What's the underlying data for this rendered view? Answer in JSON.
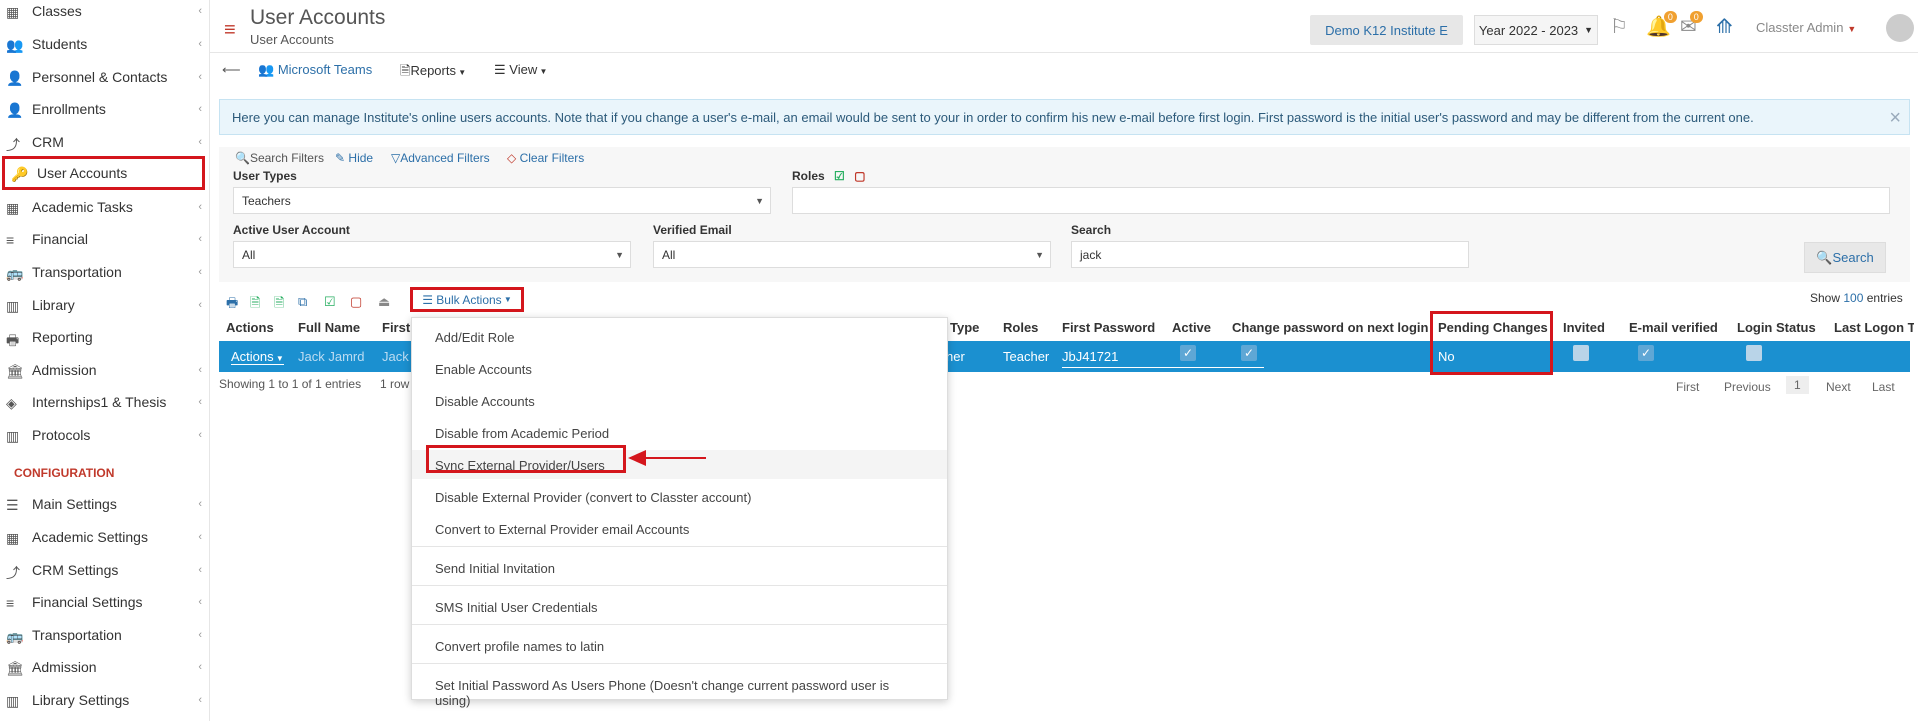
{
  "sidebar": {
    "items": [
      {
        "label": "Classes",
        "icon": "classes-icon"
      },
      {
        "label": "Students",
        "icon": "students-icon"
      },
      {
        "label": "Personnel & Contacts",
        "icon": "personnel-icon"
      },
      {
        "label": "Enrollments",
        "icon": "enrollments-icon"
      },
      {
        "label": "CRM",
        "icon": "crm-icon"
      },
      {
        "label": "User Accounts",
        "icon": "key-icon"
      },
      {
        "label": "Academic Tasks",
        "icon": "tasks-icon"
      },
      {
        "label": "Financial",
        "icon": "financial-icon"
      },
      {
        "label": "Transportation",
        "icon": "bus-icon"
      },
      {
        "label": "Library",
        "icon": "library-icon"
      },
      {
        "label": "Reporting",
        "icon": "reporting-icon"
      },
      {
        "label": "Admission",
        "icon": "admission-icon"
      },
      {
        "label": "Internships1 & Thesis",
        "icon": "internship-icon"
      },
      {
        "label": "Protocols",
        "icon": "protocols-icon"
      }
    ],
    "config_heading": "CONFIGURATION",
    "config_items": [
      {
        "label": "Main Settings",
        "icon": "settings-icon"
      },
      {
        "label": "Academic Settings",
        "icon": "classes-icon"
      },
      {
        "label": "CRM Settings",
        "icon": "crm-icon"
      },
      {
        "label": "Financial Settings",
        "icon": "financial-icon"
      },
      {
        "label": "Transportation",
        "icon": "bus-icon"
      },
      {
        "label": "Admission",
        "icon": "admission-icon"
      },
      {
        "label": "Library Settings",
        "icon": "library-icon"
      }
    ]
  },
  "header": {
    "title": "User Accounts",
    "subtitle": "User Accounts",
    "institute": "Demo K12 Institute E",
    "year": "Year 2022 - 2023",
    "notif_count": "0",
    "mail_count": "0",
    "user": "Classter Admin"
  },
  "toolbar": {
    "teams": "Microsoft Teams",
    "reports": "Reports",
    "view": "View"
  },
  "notice": "Here you can manage Institute's online users accounts. Note that if you change a user's e-mail, an email would be sent to your in order to confirm his new e-mail before first login. First password is the initial user's password and may be different from the current one.",
  "filters": {
    "search_filters": "Search Filters",
    "hide": "Hide",
    "advanced": "Advanced Filters",
    "clear": "Clear Filters",
    "user_types_label": "User Types",
    "user_types_value": "Teachers",
    "roles_label": "Roles",
    "active_label": "Active User Account",
    "active_value": "All",
    "verified_label": "Verified Email",
    "verified_value": "All",
    "search_label": "Search",
    "search_value": "jack",
    "search_button": "Search"
  },
  "table": {
    "bulk_actions": "Bulk Actions",
    "show_prefix": "Show",
    "show_count": "100",
    "show_suffix": "entries",
    "headers": {
      "actions": "Actions",
      "full_name": "Full Name",
      "first": "First",
      "type": "Type",
      "roles": "Roles",
      "first_password": "First Password",
      "active": "Active",
      "change_pw": "Change password on next login",
      "pending": "Pending Changes",
      "invited": "Invited",
      "email_verified": "E-mail verified",
      "login_status": "Login Status",
      "last_logon": "Last Logon Ti"
    },
    "row": {
      "actions": "Actions",
      "full_name": "Jack Jamrd",
      "first": "Jack",
      "type": "her",
      "roles": "Teacher",
      "first_password": "JbJ41721",
      "pending": "No"
    },
    "info": "Showing 1 to 1 of 1 entries",
    "rows_selected": "1 row",
    "pagination": {
      "first": "First",
      "previous": "Previous",
      "current": "1",
      "next": "Next",
      "last": "Last"
    }
  },
  "bulk_menu": {
    "items": [
      "Add/Edit Role",
      "Enable Accounts",
      "Disable Accounts",
      "Disable from Academic Period",
      "Sync External Provider/Users",
      "Disable External Provider (convert to Classter account)",
      "Convert to External Provider email Accounts",
      "Send Initial Invitation",
      "SMS Initial User Credentials",
      "Convert profile names to latin",
      "Set Initial Password As Users Phone (Doesn't change current password user is using)"
    ]
  },
  "colors": {
    "accent": "#2c6fa8",
    "highlight": "#d4161c",
    "row_selected": "#1b90d0"
  }
}
